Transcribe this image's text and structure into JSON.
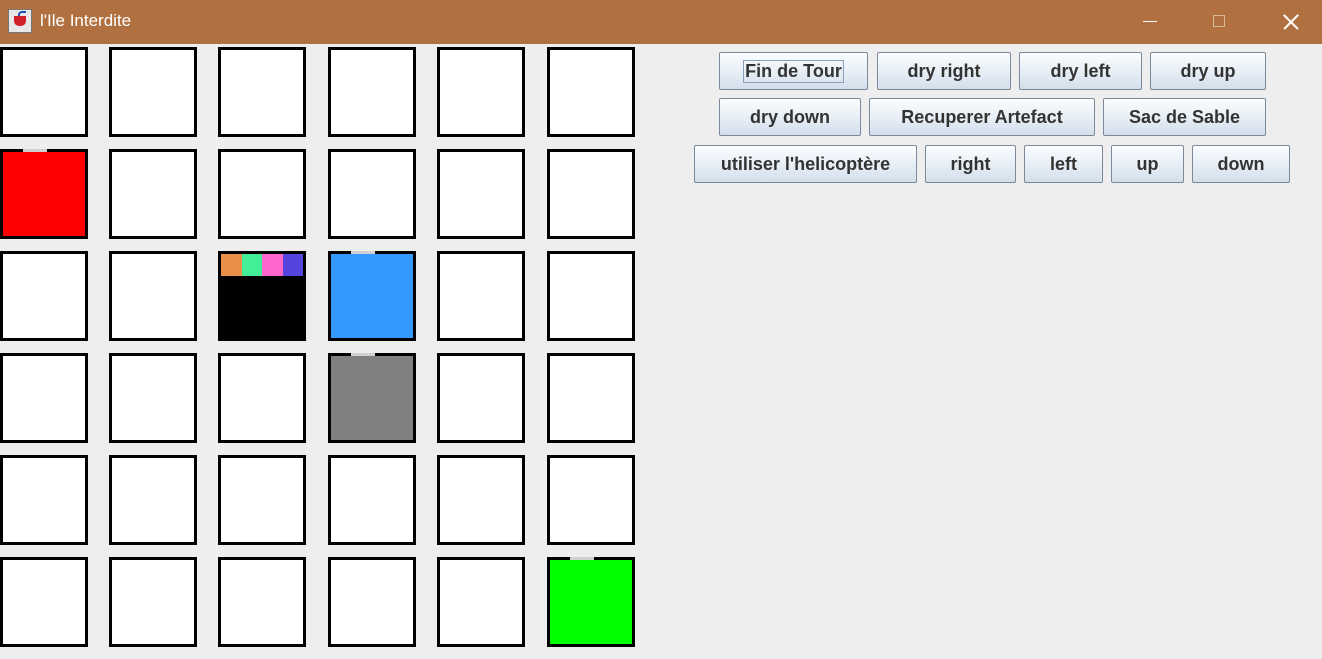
{
  "window": {
    "title": "l'Ile Interdite"
  },
  "icons": {
    "app": "java-cup-icon",
    "minimize": "minimize-icon",
    "maximize": "maximize-icon",
    "close": "close-icon"
  },
  "colors": {
    "titlebar": "#b07040",
    "background": "#eeeeee",
    "empty_tile": "#ffffff",
    "player_red": "#ff0000",
    "player_blue": "#3399ff",
    "player_gray": "#808080",
    "player_green": "#00ff00",
    "artifact_tile": "#000000",
    "artifact_orange": "#e8904a",
    "artifact_mint": "#44ee99",
    "artifact_pink": "#ff66cc",
    "artifact_purple": "#5544dd"
  },
  "grid": {
    "rows": 6,
    "cols": 6,
    "special_tiles": [
      {
        "row": 1,
        "col": 0,
        "type": "player",
        "color": "#ff0000"
      },
      {
        "row": 2,
        "col": 2,
        "type": "artifacts",
        "color": "#000000",
        "artifacts": [
          "#e8904a",
          "#44ee99",
          "#ff66cc",
          "#5544dd"
        ]
      },
      {
        "row": 2,
        "col": 3,
        "type": "player",
        "color": "#3399ff"
      },
      {
        "row": 3,
        "col": 3,
        "type": "player",
        "color": "#808080"
      },
      {
        "row": 5,
        "col": 5,
        "type": "player",
        "color": "#00ff00"
      }
    ]
  },
  "controls": {
    "fin_de_tour": "Fin de Tour",
    "dry_right": "dry right",
    "dry_left": "dry left",
    "dry_up": "dry up",
    "dry_down": "dry down",
    "recuperer_artefact": "Recuperer Artefact",
    "sac_de_sable": "Sac de Sable",
    "utiliser_helicoptere": "utiliser l'helicoptère",
    "right": "right",
    "left": "left",
    "up": "up",
    "down": "down"
  }
}
